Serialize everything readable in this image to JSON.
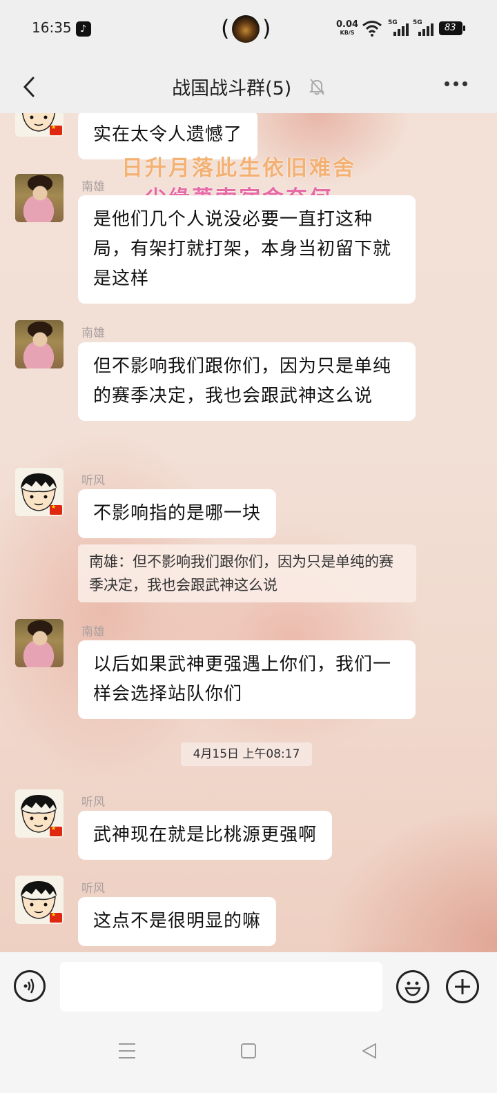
{
  "status_bar": {
    "time": "16:35",
    "net_speed_value": "0.04",
    "net_speed_unit": "KB/S",
    "signal1_label": "5G",
    "signal2_label": "5G",
    "battery_level": "83",
    "icons": [
      "tiktok-icon",
      "wifi-icon",
      "signal-icon",
      "battery-icon"
    ]
  },
  "header": {
    "title": "战国战斗群(5)",
    "back_icon": "chevron-left-icon",
    "mute_icon": "bell-off-icon",
    "more_icon": "more-dots-icon"
  },
  "watermark": {
    "line1": "日升月落此生依旧难舍",
    "line2": "尘缘萧索宿命奈何"
  },
  "messages": [
    {
      "sender": "",
      "text": "实在太令人遗憾了"
    },
    {
      "sender": "南雄",
      "text": "是他们几个人说没必要一直打这种局，有架打就打架，本身当初留下就是这样"
    },
    {
      "sender": "南雄",
      "text": "但不影响我们跟你们，因为只是单纯的赛季决定，我也会跟武神这么说"
    },
    {
      "sender": "听风",
      "text": "不影响指的是哪一块",
      "quote": "南雄：但不影响我们跟你们，因为只是单纯的赛季决定，我也会跟武神这么说"
    },
    {
      "sender": "南雄",
      "text": "以后如果武神更强遇上你们，我们一样会选择站队你们"
    },
    {
      "sender": "听风",
      "text": "武神现在就是比桃源更强啊"
    },
    {
      "sender": "听风",
      "text": "这点不是很明显的嘛"
    }
  ],
  "timestamp": "4月15日 上午08:17",
  "input_bar": {
    "placeholder": "",
    "voice_icon": "voice-icon",
    "emoji_icon": "emoji-icon",
    "plus_icon": "plus-icon"
  },
  "nav_bar": {
    "icons": [
      "menu-icon",
      "home-icon",
      "back-triangle-icon"
    ]
  },
  "colors": {
    "bubble": "#ffffff",
    "sender_name": "#aaa0a0",
    "watermark_orange": "#f3b174",
    "watermark_pink": "#e66aa6",
    "flag_red": "#de2910"
  }
}
